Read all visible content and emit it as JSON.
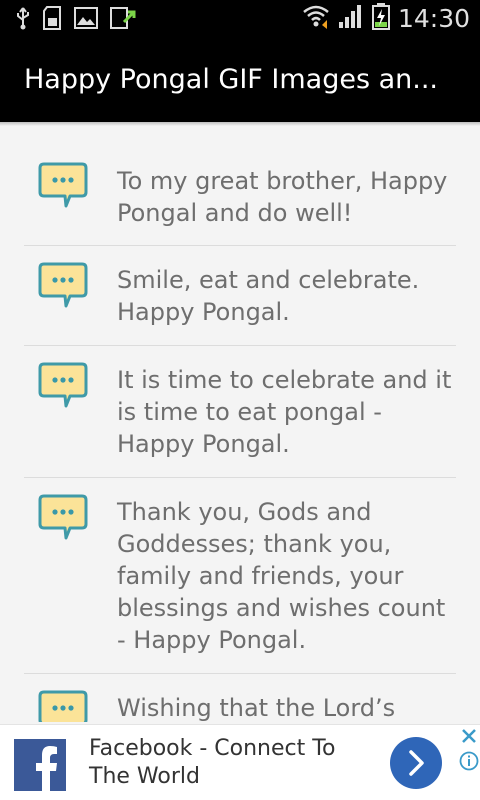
{
  "status_bar": {
    "left_icons": [
      "usb-icon",
      "sd-card-icon",
      "image-icon",
      "download-icon"
    ],
    "right_icons": [
      "wifi-icon",
      "signal-icon",
      "battery-icon"
    ],
    "time": "14:30"
  },
  "app_bar": {
    "title": "Happy Pongal GIF Images an..."
  },
  "messages": [
    {
      "icon": "chat-bubble-icon",
      "text": "To my great brother, Happy Pongal and do well!"
    },
    {
      "icon": "chat-bubble-icon",
      "text": "Smile, eat and celebrate. Happy Pongal."
    },
    {
      "icon": "chat-bubble-icon",
      "text": "It is time to celebrate and it is time to eat pongal - Happy Pongal."
    },
    {
      "icon": "chat-bubble-icon",
      "text": "Thank you, Gods and Goddesses; thank you, family and friends, your blessings and wishes count - Happy Pongal."
    },
    {
      "icon": "chat-bubble-icon",
      "text": "Wishing that the Lord’s"
    }
  ],
  "ad": {
    "logo": "facebook-logo-icon",
    "text": "Facebook - Connect To The World",
    "action_icon": "chevron-right-icon",
    "close_icon": "ad-close-icon",
    "info_icon": "ad-info-icon"
  },
  "colors": {
    "bubble_fill": "#fbe398",
    "bubble_stroke": "#3f9aa8",
    "dot": "#3a98a8",
    "text": "#6e6e6e",
    "facebook_blue": "#3b5998",
    "action_blue": "#2f66b8"
  }
}
